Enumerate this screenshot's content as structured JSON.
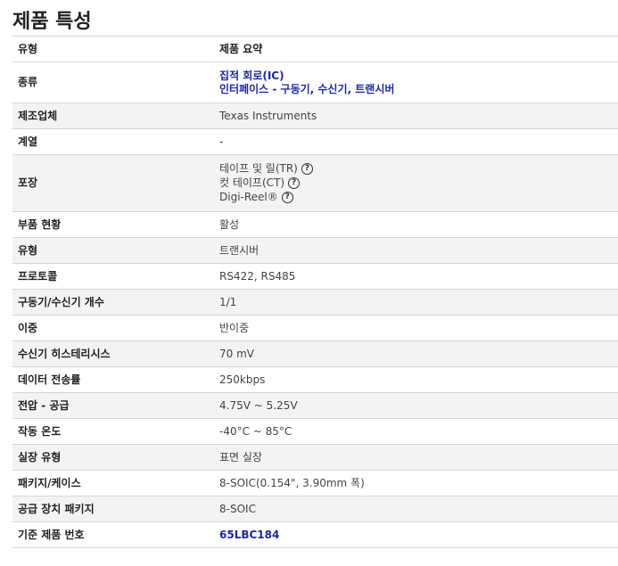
{
  "title": "제품 특성",
  "header": {
    "col1": "유형",
    "col2": "제품 요약"
  },
  "rows": {
    "category": {
      "label": "종류",
      "values": [
        "집적 회로(IC)",
        "인터페이스 - 구동기, 수신기, 트랜시버"
      ]
    },
    "manufacturer": {
      "label": "제조업체",
      "value": "Texas Instruments"
    },
    "series": {
      "label": "계열",
      "value": "-"
    },
    "packaging": {
      "label": "포장",
      "values": [
        "테이프 및 릴(TR)",
        "컷 테이프(CT)",
        "Digi-Reel®"
      ],
      "help": "?"
    },
    "part_status": {
      "label": "부품 현황",
      "value": "활성"
    },
    "type": {
      "label": "유형",
      "value": "트랜시버"
    },
    "protocol": {
      "label": "프로토콜",
      "value": "RS422, RS485"
    },
    "drivers_receivers": {
      "label": "구동기/수신기 개수",
      "value": "1/1"
    },
    "duplex": {
      "label": "이중",
      "value": "반이중"
    },
    "receiver_hysteresis": {
      "label": "수신기 히스테리시스",
      "value": "70 mV"
    },
    "data_rate": {
      "label": "데이터 전송률",
      "value": "250kbps"
    },
    "voltage_supply": {
      "label": "전압 - 공급",
      "value": "4.75V ~ 5.25V"
    },
    "operating_temp": {
      "label": "작동 온도",
      "value": "-40°C ~ 85°C"
    },
    "mounting_type": {
      "label": "실장 유형",
      "value": "표면 실장"
    },
    "package_case": {
      "label": "패키지/케이스",
      "value": "8-SOIC(0.154\", 3.90mm 폭)"
    },
    "supplier_package": {
      "label": "공급 장치 패키지",
      "value": "8-SOIC"
    },
    "base_part": {
      "label": "기준 제품 번호",
      "value": "65LBC184"
    }
  },
  "colors": {
    "link": "#1c2a9c",
    "row_alt": "#f3f3f3",
    "border": "#d6d6d6"
  }
}
